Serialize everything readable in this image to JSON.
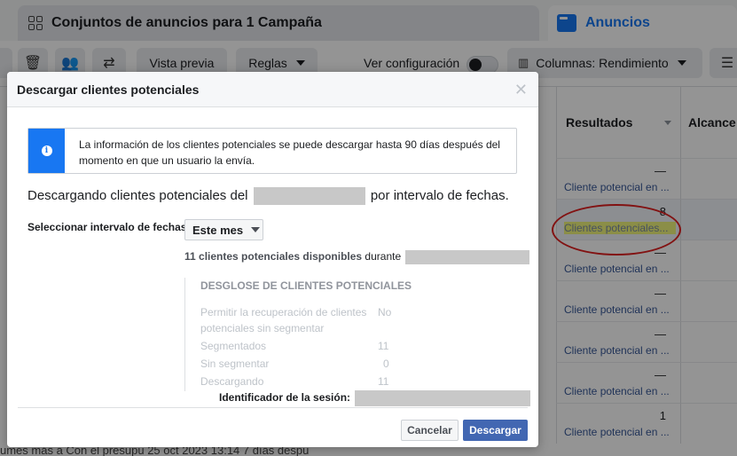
{
  "tabs": {
    "adsets_label": "Conjuntos de anuncios para 1 Campaña",
    "ads_label": "Anuncios"
  },
  "toolbar": {
    "preview_label": "Vista previa",
    "rules_label": "Reglas",
    "view_config_label": "Ver configuración",
    "columns_label": "Columnas: Rendimiento"
  },
  "table": {
    "col_results": "Resultados",
    "col_reach": "Alcance",
    "rows": [
      {
        "value": "—",
        "link": "Cliente potencial en ..."
      },
      {
        "value": "8",
        "link": "Clientes potenciales..."
      },
      {
        "value": "—",
        "link": "Cliente potencial en ..."
      },
      {
        "value": "—",
        "link": "Cliente potencial en ..."
      },
      {
        "value": "—",
        "link": "Cliente potencial en ..."
      },
      {
        "value": "—",
        "link": "Cliente potencial en ..."
      },
      {
        "value": "1",
        "link": "Cliente potencial en ..."
      }
    ],
    "bottom_row": "umes más a      Con el presupu       25 oct 2023 13:14                                                 7 días despu"
  },
  "modal": {
    "title": "Descargar clientes potenciales",
    "info_text": "La información de los clientes potenciales se puede descargar hasta 90 días después del momento en que un usuario la envía.",
    "downloading_prefix": "Descargando clientes potenciales del",
    "downloading_suffix": "por intervalo de fechas.",
    "range_label": "Seleccionar intervalo de fechas",
    "range_value": "Este mes",
    "available_bold": "11 clientes potenciales disponibles",
    "available_suffix": "durante",
    "breakdown": {
      "title": "DESGLOSE DE CLIENTES POTENCIALES",
      "rows": [
        {
          "label": "Permitir la recuperación de clientes potenciales sin segmentar",
          "value": "No"
        },
        {
          "label": "Segmentados",
          "value": "11"
        },
        {
          "label": "Sin segmentar",
          "value": "0"
        },
        {
          "label": "Descargando",
          "value": "11"
        }
      ]
    },
    "session_label": "Identificador de la sesión:",
    "cancel_label": "Cancelar",
    "download_label": "Descargar"
  }
}
